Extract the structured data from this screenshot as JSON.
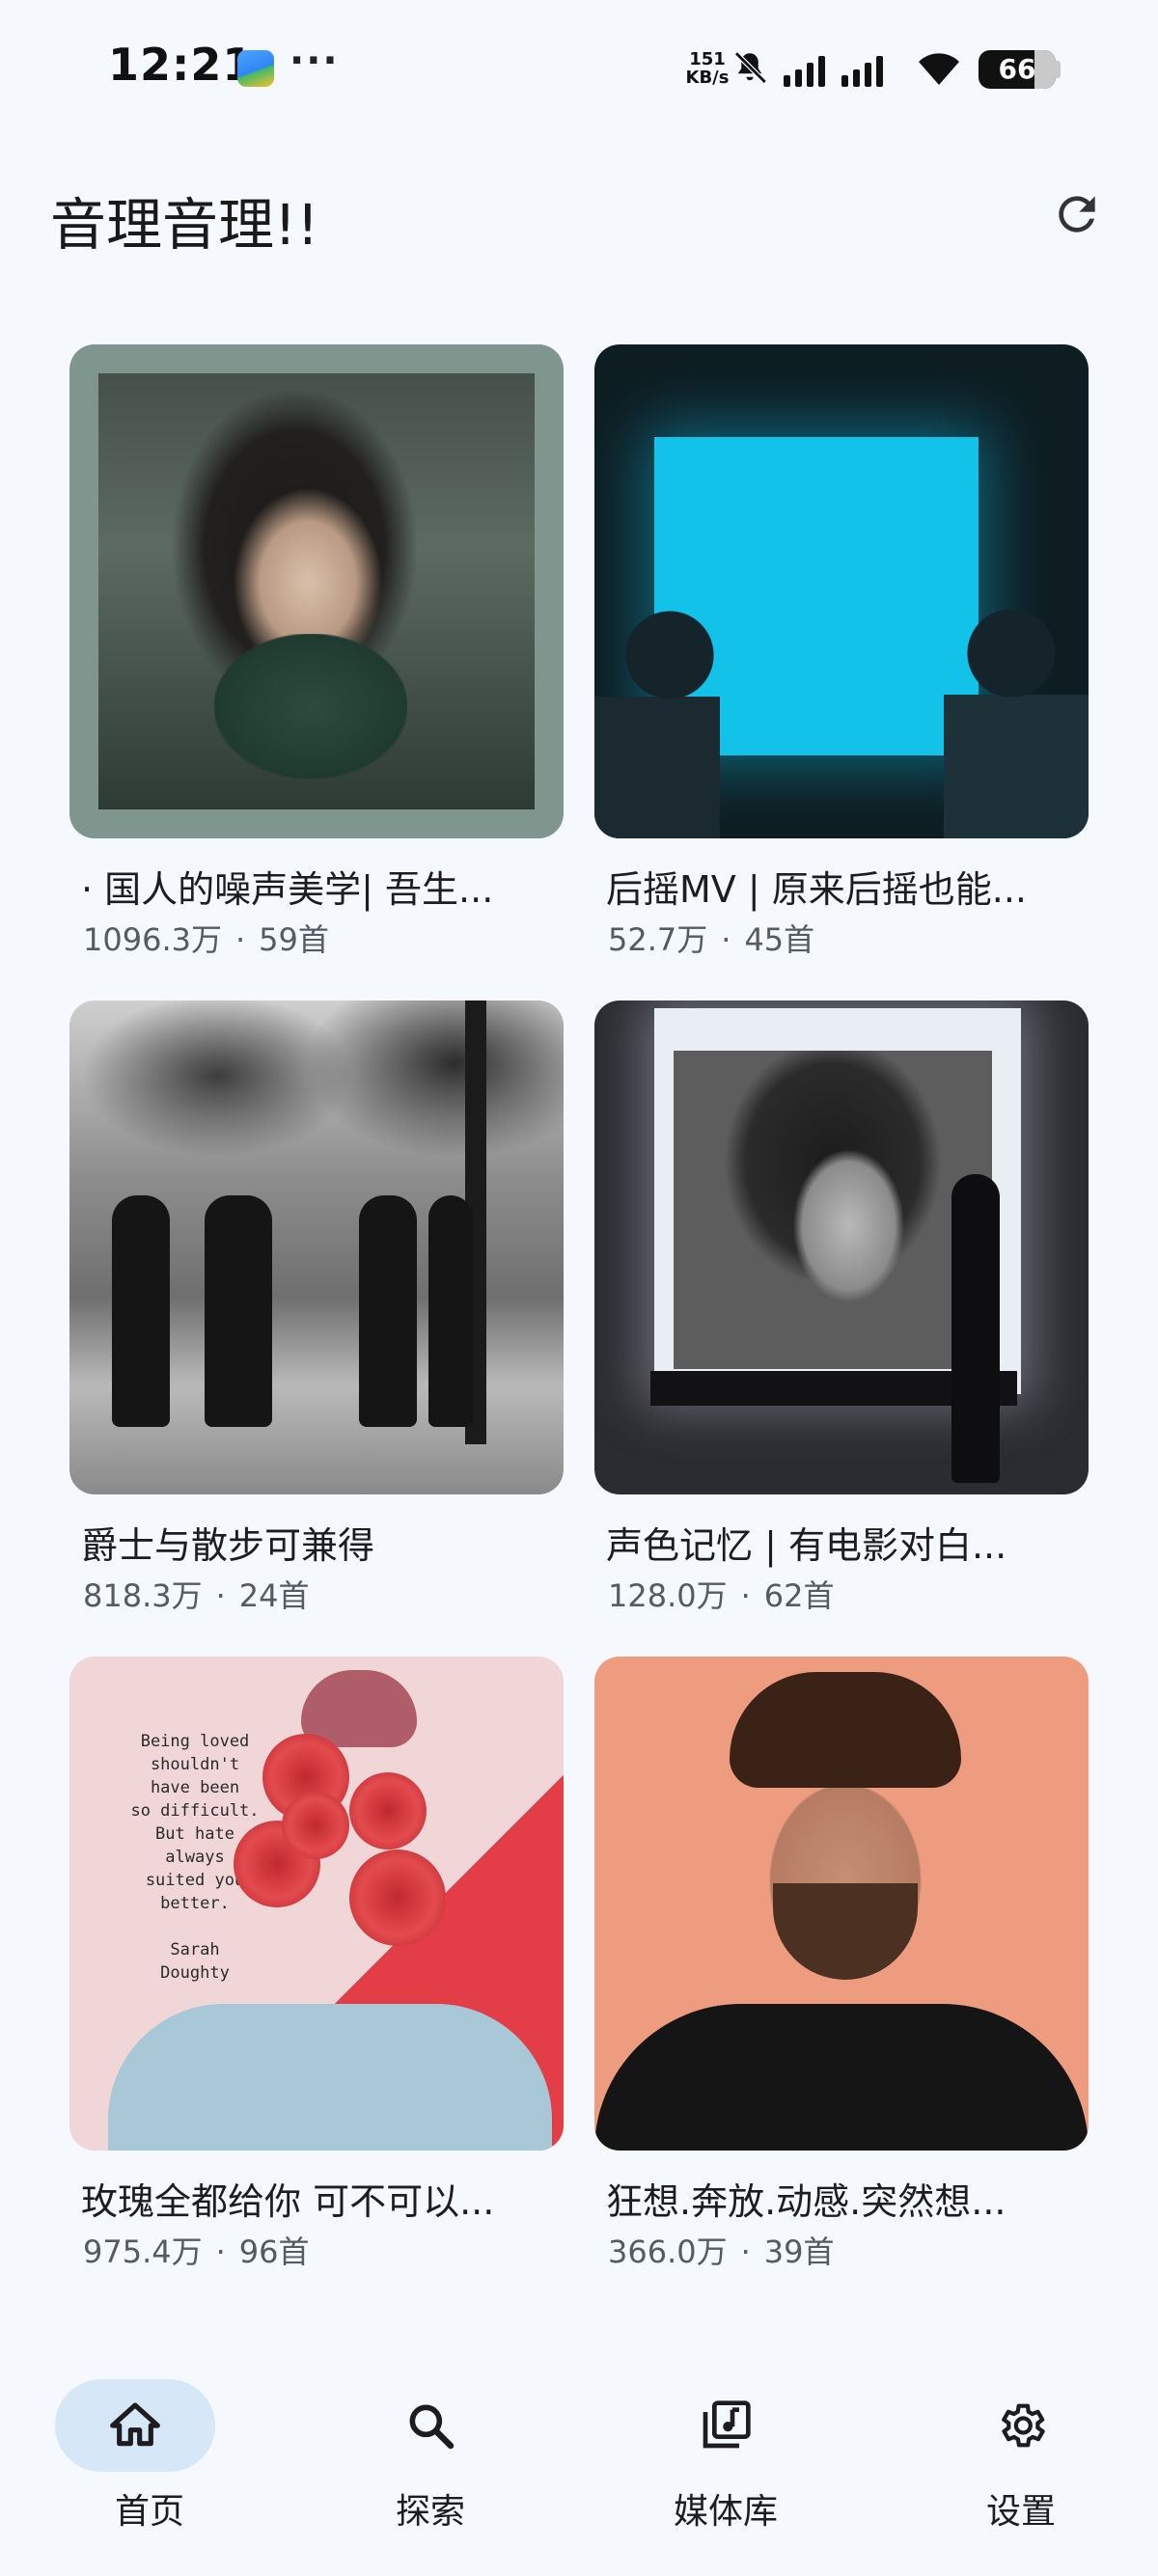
{
  "status_bar": {
    "time": "12:21",
    "more": "···",
    "net_speed_value": "151",
    "net_speed_unit": "KB/s",
    "battery": "66"
  },
  "header": {
    "title": "音理音理!!"
  },
  "playlists": [
    {
      "title": "· 国人的噪声美学| 吾生...",
      "plays": "1096.3万",
      "count": "59首"
    },
    {
      "title": "后摇MV | 原来后摇也能...",
      "plays": "52.7万",
      "count": "45首"
    },
    {
      "title": "爵士与散步可兼得",
      "plays": "818.3万",
      "count": "24首"
    },
    {
      "title": "声色记忆 | 有电影对白...",
      "plays": "128.0万",
      "count": "62首"
    },
    {
      "title": "玫瑰全都给你 可不可以...",
      "plays": "975.4万",
      "count": "96首"
    },
    {
      "title": "狂想.奔放.动感.突然想...",
      "plays": "366.0万",
      "count": "39首"
    }
  ],
  "cover_text": {
    "quote": "Being loved\nshouldn't\nhave been\nso difficult.\nBut hate\nalways\nsuited you\nbetter.\n\nSarah\nDoughty"
  },
  "meta_separator": "·",
  "bottom_nav": [
    {
      "label": "首页",
      "icon": "home-icon",
      "active": true
    },
    {
      "label": "探索",
      "icon": "search-icon",
      "active": false
    },
    {
      "label": "媒体库",
      "icon": "music-library-icon",
      "active": false
    },
    {
      "label": "设置",
      "icon": "gear-icon",
      "active": false
    }
  ],
  "colors": {
    "background": "#f5f8fd",
    "active_pill": "#d6e7f7",
    "text_primary": "#1d1d1f",
    "text_secondary": "#555b63"
  }
}
